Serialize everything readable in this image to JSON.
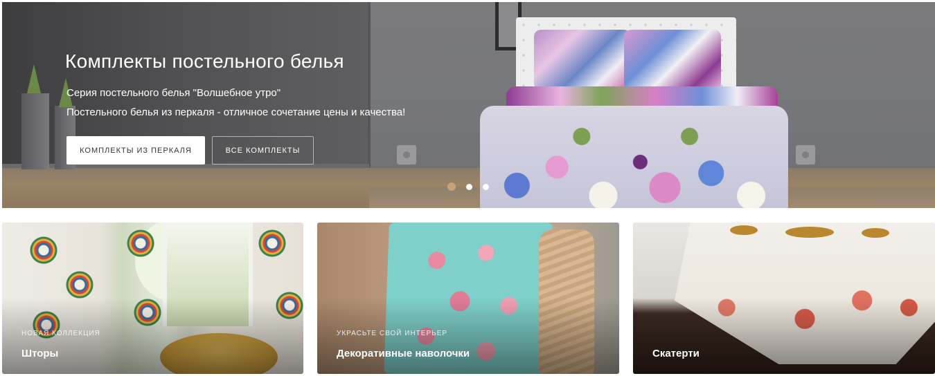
{
  "hero": {
    "title": "Комплекты постельного белья",
    "line1": "Серия постельного белья \"Волшебное утро\"",
    "line2": "Постельного белья из перкаля - отличное сочетание цены и качества!",
    "buttons": {
      "primary": "Комплекты из перкаля",
      "secondary": "Все комплекты"
    },
    "slider": {
      "count": 3,
      "active": 1,
      "active_color": "#c7a27a"
    }
  },
  "cards": [
    {
      "kicker": "Новая коллекция",
      "title": "Шторы"
    },
    {
      "kicker": "Украсьте свой интерьер",
      "title": "Декоративные наволочки"
    },
    {
      "kicker": "",
      "title": "Скатерти"
    }
  ]
}
